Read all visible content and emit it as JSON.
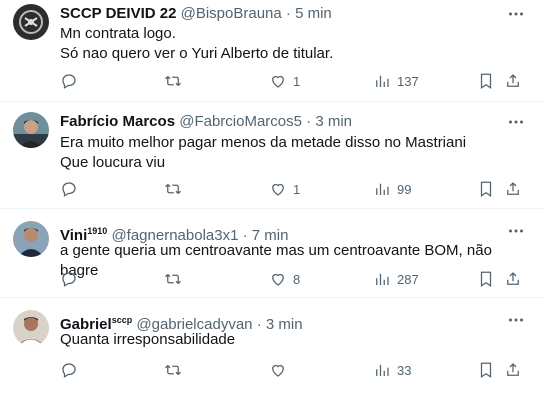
{
  "tweets": [
    {
      "name": "SCCP DEIVID 22",
      "name_suffix": "",
      "handle": "@BispoBrauna",
      "separator": "·",
      "time": "5 min",
      "lines": [
        "Mn contrata logo.",
        "Só nao quero ver o Yuri Alberto de titular."
      ],
      "replies": "",
      "retweets": "",
      "likes": "1",
      "views": "137",
      "avatar_color": "#3a3a3a"
    },
    {
      "name": "Fabrício Marcos",
      "name_suffix": "",
      "handle": "@FabrcioMarcos5",
      "separator": "·",
      "time": "3 min",
      "lines": [
        "Era muito melhor pagar menos da metade disso no Mastriani",
        "Que loucura viu"
      ],
      "replies": "",
      "retweets": "",
      "likes": "1",
      "views": "99",
      "avatar_color": "#4a6a7a"
    },
    {
      "name": "Vini",
      "name_suffix": "1910",
      "handle": "@fagnernabola3x1",
      "separator": "·",
      "time": "7 min",
      "lines": [
        "a gente queria um centroavante mas um centroavante BOM, não bagre"
      ],
      "replies": "",
      "retweets": "",
      "likes": "8",
      "views": "287",
      "avatar_color": "#5a6e88"
    },
    {
      "name": "Gabriel",
      "name_suffix": "sccp",
      "handle": "@gabrielcadyvan",
      "separator": "·",
      "time": "3 min",
      "lines": [
        "Quanta irresponsabilidade"
      ],
      "replies": "",
      "retweets": "",
      "likes": "",
      "views": "33",
      "avatar_color": "#7a5a50"
    }
  ],
  "icons": {
    "more": "more-horizontal-icon",
    "reply": "reply-bubble-icon",
    "retweet": "retweet-arrows-icon",
    "like": "heart-icon",
    "views": "views-bar-chart-icon",
    "bookmark": "bookmark-icon",
    "share": "share-upload-icon"
  },
  "colors": {
    "text": "#0f1419",
    "secondary": "#536471",
    "divider": "#eff3f4"
  }
}
